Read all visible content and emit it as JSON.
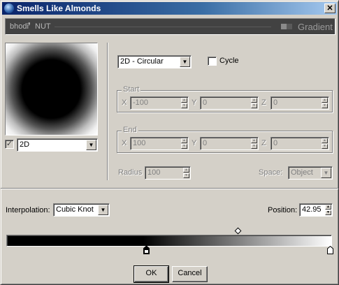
{
  "window": {
    "title": "Smells Like Almonds"
  },
  "banner": {
    "logo_left": "bhodi",
    "logo_right": "NUT",
    "title": "Gradient"
  },
  "gradient_type": {
    "selected": "2D - Circular"
  },
  "cycle": {
    "label": "Cycle",
    "checked": false
  },
  "preview_mode": {
    "checked": true,
    "selected": "2D"
  },
  "start": {
    "title": "Start",
    "x_label": "X",
    "x_value": "-100",
    "y_label": "Y",
    "y_value": "0",
    "z_label": "Z",
    "z_value": "0"
  },
  "end": {
    "title": "End",
    "x_label": "X",
    "x_value": "100",
    "y_label": "Y",
    "y_value": "0",
    "z_label": "Z",
    "z_value": "0"
  },
  "radius": {
    "label": "Radius",
    "value": "100"
  },
  "space": {
    "label": "Space:",
    "selected": "Object"
  },
  "interpolation": {
    "label": "Interpolation:",
    "selected": "Cubic Knot"
  },
  "position": {
    "label": "Position:",
    "value": "42.95"
  },
  "buttons": {
    "ok": "OK",
    "cancel": "Cancel"
  },
  "colors": {
    "title_start": "#0a246a",
    "title_end": "#a6caf0",
    "face": "#d4d0c8",
    "banner": "#424242"
  }
}
